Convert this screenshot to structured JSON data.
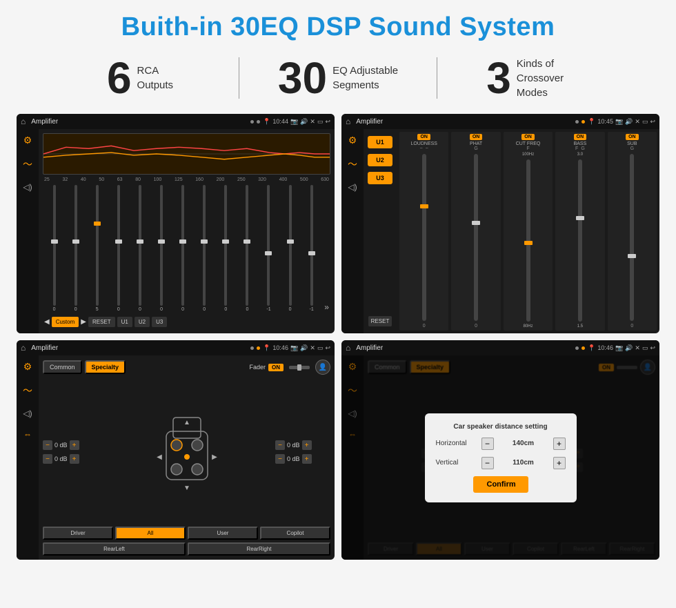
{
  "page": {
    "title": "Buith-in 30EQ DSP Sound System",
    "stats": [
      {
        "number": "6",
        "text": "RCA\nOutputs"
      },
      {
        "number": "30",
        "text": "EQ Adjustable\nSegments"
      },
      {
        "number": "3",
        "text": "Kinds of\nCrossover Modes"
      }
    ],
    "screens": [
      {
        "id": "screen1",
        "label": "EQ Screen",
        "statusBar": {
          "title": "Amplifier",
          "time": "10:44"
        },
        "eqFreqs": [
          "25",
          "32",
          "40",
          "50",
          "63",
          "80",
          "100",
          "125",
          "160",
          "200",
          "250",
          "320",
          "400",
          "500",
          "630"
        ],
        "eqVals": [
          "0",
          "0",
          "0",
          "5",
          "0",
          "0",
          "0",
          "0",
          "0",
          "0",
          "0",
          "-1",
          "0",
          "-1"
        ],
        "bottomBtns": [
          "Custom",
          "RESET",
          "U1",
          "U2",
          "U3"
        ]
      },
      {
        "id": "screen2",
        "label": "Crossover Screen",
        "statusBar": {
          "title": "Amplifier",
          "time": "10:45"
        },
        "uBtns": [
          "U1",
          "U2",
          "U3"
        ],
        "channels": [
          "LOUDNESS",
          "PHAT",
          "CUT FREQ",
          "BASS",
          "SUB"
        ],
        "onBadge": "ON"
      },
      {
        "id": "screen3",
        "label": "Fader Screen",
        "statusBar": {
          "title": "Amplifier",
          "time": "10:46"
        },
        "tabs": [
          "Common",
          "Specialty"
        ],
        "faderLabel": "Fader",
        "onBadge": "ON",
        "dbValues": [
          "0 dB",
          "0 dB",
          "0 dB",
          "0 dB"
        ],
        "locationBtns": [
          "Driver",
          "RearLeft",
          "All",
          "User",
          "Copilot",
          "RearRight"
        ]
      },
      {
        "id": "screen4",
        "label": "Distance Setting Screen",
        "statusBar": {
          "title": "Amplifier",
          "time": "10:46"
        },
        "tabs": [
          "Common",
          "Specialty"
        ],
        "dialog": {
          "title": "Car speaker distance setting",
          "horizontal": {
            "label": "Horizontal",
            "value": "140cm"
          },
          "vertical": {
            "label": "Vertical",
            "value": "110cm"
          },
          "confirmBtn": "Confirm"
        },
        "locationBtns": [
          "Driver",
          "RearLeft",
          "All",
          "User",
          "Copilot",
          "RearRight"
        ]
      }
    ]
  }
}
